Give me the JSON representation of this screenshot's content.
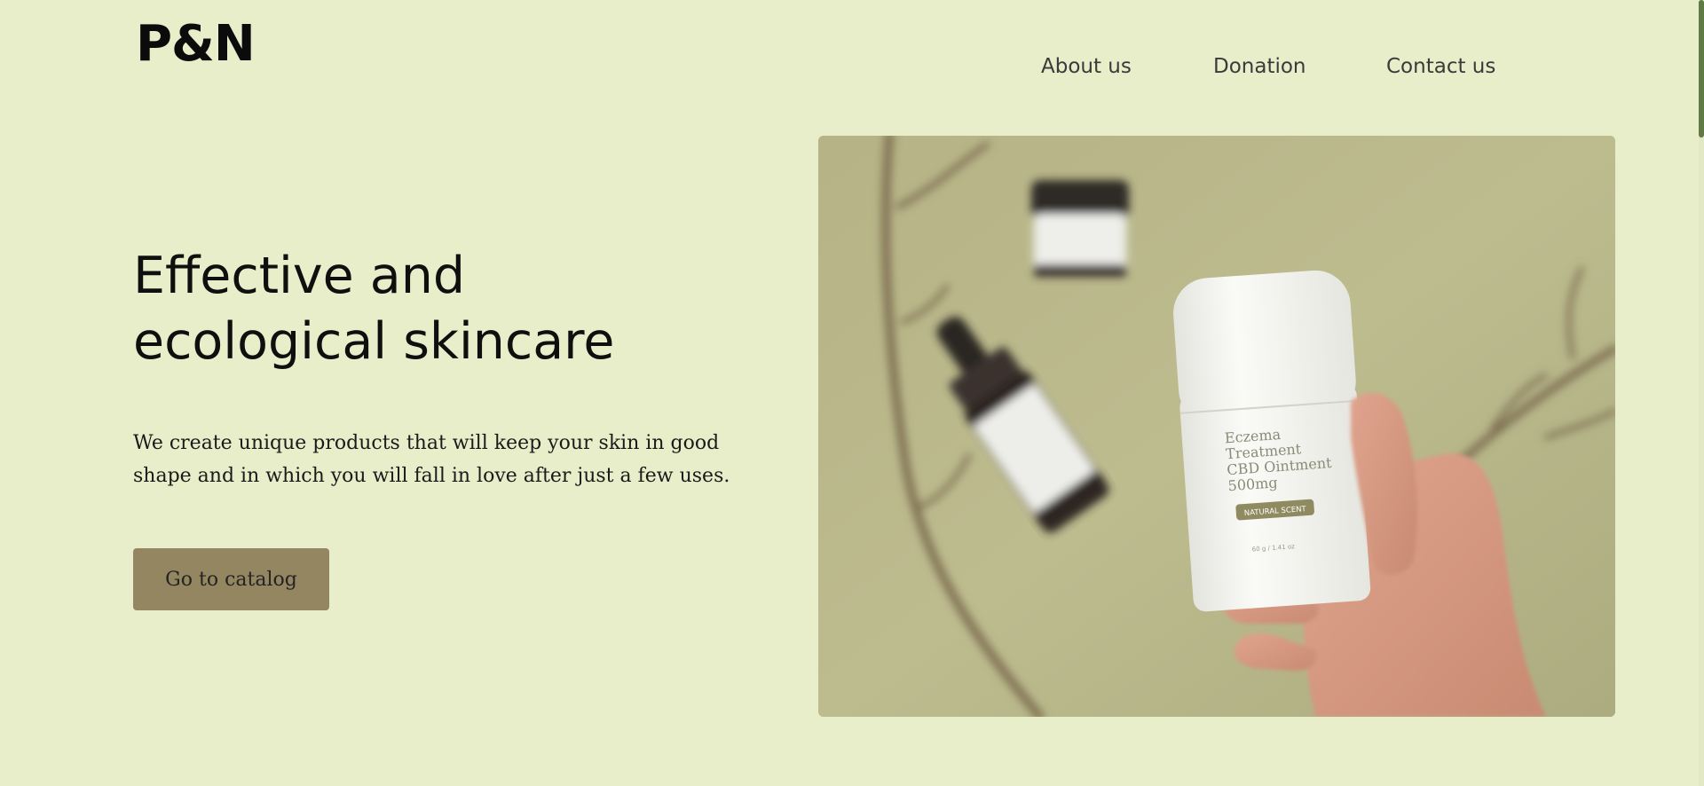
{
  "brand": {
    "logo": "P&N"
  },
  "nav": {
    "items": [
      {
        "label": "About us"
      },
      {
        "label": "Donation"
      },
      {
        "label": "Contact us"
      }
    ]
  },
  "hero": {
    "headline_line1": "Effective and",
    "headline_line2": "ecological skincare",
    "description_line1": "We create unique products that will keep your skin in good",
    "description_line2": "shape and in which you will fall in love after just a few uses.",
    "cta_label": "Go to catalog",
    "image": {
      "product_label": [
        "Eczema",
        "Treatment",
        "CBD Ointment",
        "500mg"
      ],
      "badge": "NATURAL SCENT",
      "weight": "60 g / 1.41 oz"
    }
  },
  "colors": {
    "page_background": "#e8eec9",
    "cta_background": "#938660",
    "scrollbar_thumb": "#5f7a45",
    "photo_backdrop": "#bab88a"
  }
}
